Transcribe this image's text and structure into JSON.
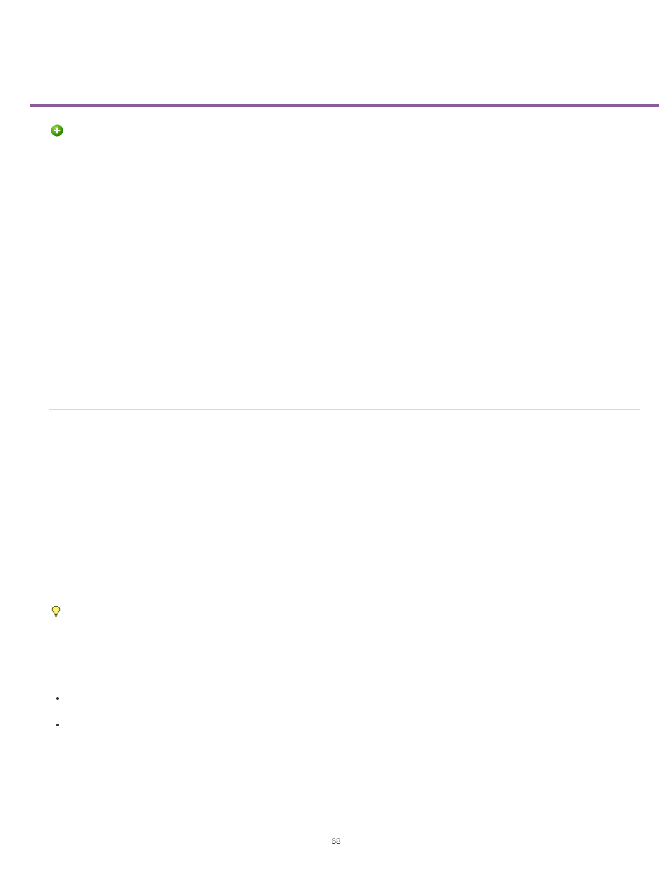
{
  "page_number": "68",
  "icons": {
    "plus": "plus-circle-icon",
    "bulb": "lightbulb-icon"
  }
}
